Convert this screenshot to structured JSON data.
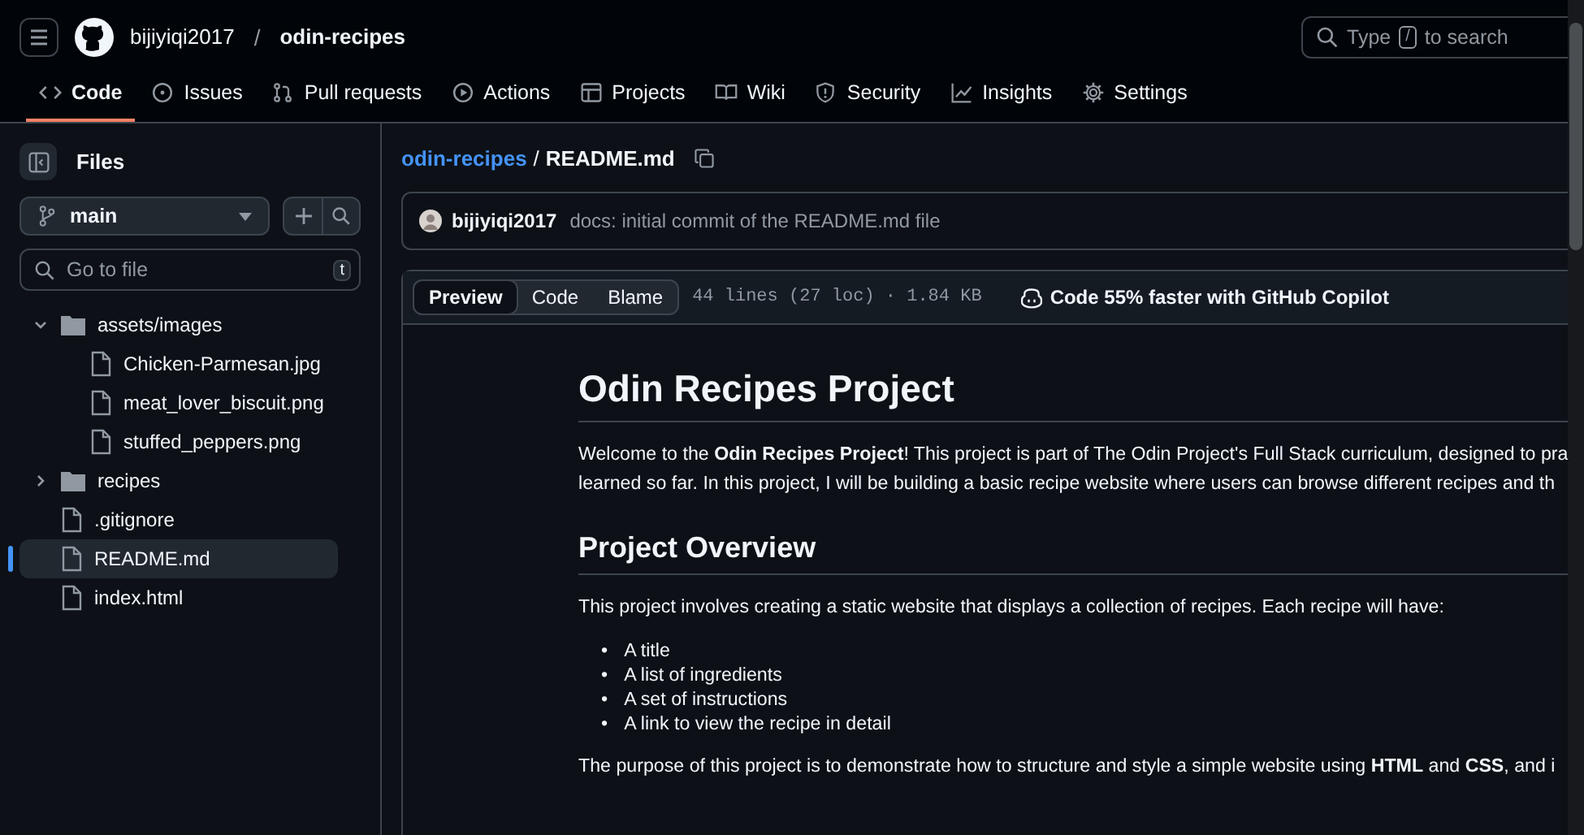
{
  "header": {
    "owner": "bijiyiqi2017",
    "separator": "/",
    "repo": "odin-recipes",
    "search": {
      "placeholder_before": "Type",
      "key": "/",
      "placeholder_after": "to search"
    }
  },
  "tabs": [
    {
      "label": "Code",
      "selected": true
    },
    {
      "label": "Issues",
      "selected": false
    },
    {
      "label": "Pull requests",
      "selected": false
    },
    {
      "label": "Actions",
      "selected": false
    },
    {
      "label": "Projects",
      "selected": false
    },
    {
      "label": "Wiki",
      "selected": false
    },
    {
      "label": "Security",
      "selected": false
    },
    {
      "label": "Insights",
      "selected": false
    },
    {
      "label": "Settings",
      "selected": false
    }
  ],
  "sidebar": {
    "title": "Files",
    "branch": "main",
    "search": {
      "placeholder": "Go to file",
      "shortcut": "t"
    },
    "tree": [
      {
        "kind": "folder",
        "name": "assets/images",
        "expanded": true,
        "selected": false,
        "children": [
          {
            "kind": "file",
            "name": "Chicken-Parmesan.jpg",
            "selected": false
          },
          {
            "kind": "file",
            "name": "meat_lover_biscuit.png",
            "selected": false
          },
          {
            "kind": "file",
            "name": "stuffed_peppers.png",
            "selected": false
          }
        ]
      },
      {
        "kind": "folder",
        "name": "recipes",
        "expanded": false,
        "selected": false
      },
      {
        "kind": "file",
        "name": ".gitignore",
        "selected": false
      },
      {
        "kind": "file",
        "name": "README.md",
        "selected": true
      },
      {
        "kind": "file",
        "name": "index.html",
        "selected": false
      }
    ]
  },
  "breadcrumb": {
    "repo": "odin-recipes",
    "separator": "/",
    "file": "README.md"
  },
  "commit": {
    "author": "bijiyiqi2017",
    "message": "docs: initial commit of the README.md file"
  },
  "file_view": {
    "modes": [
      {
        "label": "Preview",
        "selected": true
      },
      {
        "label": "Code",
        "selected": false
      },
      {
        "label": "Blame",
        "selected": false
      }
    ],
    "meta": "44 lines (27 loc) · 1.84 KB",
    "copilot": "Code 55% faster with GitHub Copilot"
  },
  "markdown": [
    {
      "kind": "h1",
      "text": "Odin Recipes Project"
    },
    {
      "kind": "p",
      "lines": [
        "Welcome to the **Odin Recipes Project**! This project is part of The Odin Project's Full Stack curriculum, designed to pra",
        "learned so far. In this project, I will be building a basic recipe website where users can browse different recipes and th"
      ]
    },
    {
      "kind": "h2",
      "text": "Project Overview"
    },
    {
      "kind": "p",
      "lines": [
        "This project involves creating a static website that displays a collection of recipes. Each recipe will have:"
      ]
    },
    {
      "kind": "ul",
      "marker": "•",
      "items": [
        "A title",
        "A list of ingredients",
        "A set of instructions",
        "A link to view the recipe in detail"
      ]
    },
    {
      "kind": "p",
      "lines": [
        "The purpose of this project is to demonstrate how to structure and style a simple website using **HTML** and **CSS**, and i"
      ]
    }
  ]
}
